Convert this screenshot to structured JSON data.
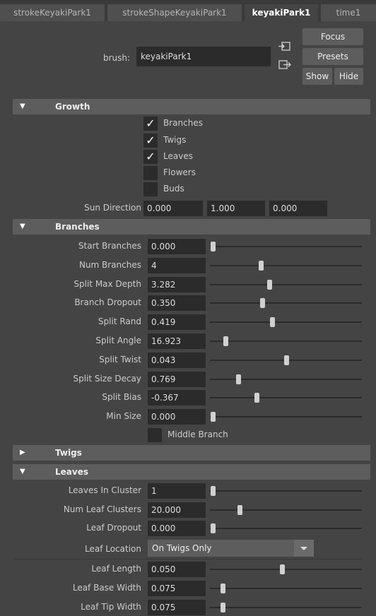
{
  "tabs": [
    {
      "label": "strokeKeyakiPark1",
      "active": false
    },
    {
      "label": "strokeShapeKeyakiPark1",
      "active": false
    },
    {
      "label": "keyakiPark1",
      "active": true
    },
    {
      "label": "time1",
      "active": false
    }
  ],
  "brush": {
    "label": "brush:",
    "value": "keyakiPark1"
  },
  "buttons": {
    "focus": "Focus",
    "presets": "Presets",
    "show": "Show",
    "hide": "Hide"
  },
  "growth": {
    "title": "Growth",
    "checks": [
      {
        "label": "Branches",
        "checked": true
      },
      {
        "label": "Twigs",
        "checked": true
      },
      {
        "label": "Leaves",
        "checked": true
      },
      {
        "label": "Flowers",
        "checked": false
      },
      {
        "label": "Buds",
        "checked": false
      }
    ],
    "sun_direction": {
      "label": "Sun Direction",
      "x": "0.000",
      "y": "1.000",
      "z": "0.000"
    }
  },
  "branches": {
    "title": "Branches",
    "rows": [
      {
        "label": "Start Branches",
        "value": "0.000",
        "slider": 0.0
      },
      {
        "label": "Num Branches",
        "value": "4",
        "slider": 0.34
      },
      {
        "label": "Split Max Depth",
        "value": "3.282",
        "slider": 0.4
      },
      {
        "label": "Branch Dropout",
        "value": "0.350",
        "slider": 0.35
      },
      {
        "label": "Split Rand",
        "value": "0.419",
        "slider": 0.42
      },
      {
        "label": "Split Angle",
        "value": "16.923",
        "slider": 0.09
      },
      {
        "label": "Split Twist",
        "value": "0.043",
        "slider": 0.52
      },
      {
        "label": "Split Size Decay",
        "value": "0.769",
        "slider": 0.18
      },
      {
        "label": "Split Bias",
        "value": "-0.367",
        "slider": 0.31
      },
      {
        "label": "Min Size",
        "value": "0.000",
        "slider": 0.0
      }
    ],
    "middle_branch": {
      "label": "Middle Branch",
      "checked": false
    }
  },
  "twigs": {
    "title": "Twigs"
  },
  "leaves": {
    "title": "Leaves",
    "rows": [
      {
        "label": "Leaves In Cluster",
        "value": "1",
        "slider": 0.0
      },
      {
        "label": "Num Leaf Clusters",
        "value": "20.000",
        "slider": 0.19
      },
      {
        "label": "Leaf Dropout",
        "value": "0.000",
        "slider": 0.0
      }
    ],
    "location": {
      "label": "Leaf Location",
      "value": "On Twigs Only"
    },
    "rows2": [
      {
        "label": "Leaf Length",
        "value": "0.050",
        "slider": 0.49
      },
      {
        "label": "Leaf Base Width",
        "value": "0.075",
        "slider": 0.07
      },
      {
        "label": "Leaf Tip Width",
        "value": "0.075",
        "slider": 0.07
      }
    ]
  }
}
